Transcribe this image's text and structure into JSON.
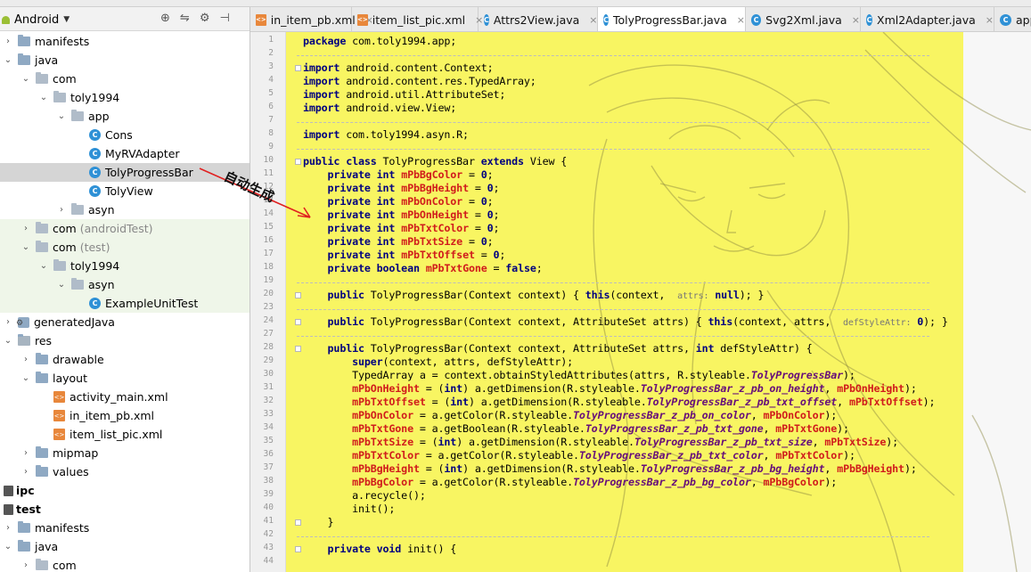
{
  "editor_tabs": [
    {
      "label": "in_item_pb.xml",
      "icon": "xml-file-icon",
      "active": false
    },
    {
      "label": "item_list_pic.xml",
      "icon": "xml-file-icon",
      "active": false
    },
    {
      "label": "Attrs2View.java",
      "icon": "class-icon",
      "active": false
    },
    {
      "label": "TolyProgressBar.java",
      "icon": "class-icon",
      "active": true
    },
    {
      "label": "Svg2Xml.java",
      "icon": "class-icon",
      "active": false
    },
    {
      "label": "Xml2Adapter.java",
      "icon": "class-icon",
      "active": false
    },
    {
      "label": "app",
      "icon": "module-icon",
      "active": false
    }
  ],
  "project_panel": {
    "view_mode": "Android",
    "tree": [
      {
        "label": "manifests",
        "indent": 0,
        "arrow": "›",
        "icon": "folder"
      },
      {
        "label": "java",
        "indent": 0,
        "arrow": "⌄",
        "icon": "folder"
      },
      {
        "label": "com",
        "indent": 1,
        "arrow": "⌄",
        "icon": "package"
      },
      {
        "label": "toly1994",
        "indent": 2,
        "arrow": "⌄",
        "icon": "package"
      },
      {
        "label": "app",
        "indent": 3,
        "arrow": "⌄",
        "icon": "package"
      },
      {
        "label": "Cons",
        "indent": 4,
        "arrow": "",
        "icon": "class"
      },
      {
        "label": "MyRVAdapter",
        "indent": 4,
        "arrow": "",
        "icon": "class"
      },
      {
        "label": "TolyProgressBar",
        "indent": 4,
        "arrow": "",
        "icon": "class",
        "selected": true
      },
      {
        "label": "TolyView",
        "indent": 4,
        "arrow": "",
        "icon": "class"
      },
      {
        "label": "asyn",
        "indent": 3,
        "arrow": "›",
        "icon": "package"
      },
      {
        "label": "com",
        "suffix": "(androidTest)",
        "indent": 1,
        "arrow": "›",
        "icon": "package",
        "test": true
      },
      {
        "label": "com",
        "suffix": "(test)",
        "indent": 1,
        "arrow": "⌄",
        "icon": "package",
        "test": true
      },
      {
        "label": "toly1994",
        "indent": 2,
        "arrow": "⌄",
        "icon": "package",
        "test": true
      },
      {
        "label": "asyn",
        "indent": 3,
        "arrow": "⌄",
        "icon": "package",
        "test": true
      },
      {
        "label": "ExampleUnitTest",
        "indent": 4,
        "arrow": "",
        "icon": "class",
        "test": true
      },
      {
        "label": "generatedJava",
        "indent": 0,
        "arrow": "›",
        "icon": "gear-folder"
      },
      {
        "label": "res",
        "indent": 0,
        "arrow": "⌄",
        "icon": "res"
      },
      {
        "label": "drawable",
        "indent": 1,
        "arrow": "›",
        "icon": "folder"
      },
      {
        "label": "layout",
        "indent": 1,
        "arrow": "⌄",
        "icon": "folder"
      },
      {
        "label": "activity_main.xml",
        "indent": 2,
        "arrow": "",
        "icon": "xml"
      },
      {
        "label": "in_item_pb.xml",
        "indent": 2,
        "arrow": "",
        "icon": "xml"
      },
      {
        "label": "item_list_pic.xml",
        "indent": 2,
        "arrow": "",
        "icon": "xml"
      },
      {
        "label": "mipmap",
        "indent": 1,
        "arrow": "›",
        "icon": "folder"
      },
      {
        "label": "values",
        "indent": 1,
        "arrow": "›",
        "icon": "folder"
      },
      {
        "label": "ipc",
        "indent": -1,
        "arrow": "",
        "icon": "module",
        "bold": true
      },
      {
        "label": "test",
        "indent": -1,
        "arrow": "",
        "icon": "module",
        "bold": true
      },
      {
        "label": "manifests",
        "indent": 0,
        "arrow": "›",
        "icon": "folder"
      },
      {
        "label": "java",
        "indent": 0,
        "arrow": "⌄",
        "icon": "folder"
      },
      {
        "label": "com",
        "indent": 1,
        "arrow": "›",
        "icon": "package"
      }
    ]
  },
  "annotation": {
    "text": "自动生成"
  },
  "code_lines": [
    {
      "n": "1",
      "html": "<span class='kw'>package</span> com.toly1994.app;"
    },
    {
      "n": "2",
      "html": ""
    },
    {
      "n": "3",
      "html": "<span class='kw'>import</span> android.content.Context;"
    },
    {
      "n": "4",
      "html": "<span class='kw'>import</span> android.content.res.TypedArray;"
    },
    {
      "n": "5",
      "html": "<span class='kw'>import</span> android.util.AttributeSet;"
    },
    {
      "n": "6",
      "html": "<span class='kw'>import</span> android.view.View;"
    },
    {
      "n": "7",
      "html": ""
    },
    {
      "n": "8",
      "html": "<span class='kw'>import</span> com.toly1994.asyn.R;"
    },
    {
      "n": "9",
      "html": ""
    },
    {
      "n": "10",
      "html": "<span class='kw'>public class</span> TolyProgressBar <span class='kw'>extends</span> View {"
    },
    {
      "n": "11",
      "html": "    <span class='kw'>private int</span> <span class='fld'>mPbBgColor</span> = <span class='kw'>0</span>;"
    },
    {
      "n": "12",
      "html": "    <span class='kw'>private int</span> <span class='fld'>mPbBgHeight</span> = <span class='kw'>0</span>;"
    },
    {
      "n": "13",
      "html": "    <span class='kw'>private int</span> <span class='fld'>mPbOnColor</span> = <span class='kw'>0</span>;"
    },
    {
      "n": "14",
      "html": "    <span class='kw'>private int</span> <span class='fld'>mPbOnHeight</span> = <span class='kw'>0</span>;"
    },
    {
      "n": "15",
      "html": "    <span class='kw'>private int</span> <span class='fld'>mPbTxtColor</span> = <span class='kw'>0</span>;"
    },
    {
      "n": "16",
      "html": "    <span class='kw'>private int</span> <span class='fld'>mPbTxtSize</span> = <span class='kw'>0</span>;"
    },
    {
      "n": "17",
      "html": "    <span class='kw'>private int</span> <span class='fld'>mPbTxtOffset</span> = <span class='kw'>0</span>;"
    },
    {
      "n": "18",
      "html": "    <span class='kw'>private boolean</span> <span class='fld'>mPbTxtGone</span> = <span class='kw'>false</span>;"
    },
    {
      "n": "19",
      "html": ""
    },
    {
      "n": "20",
      "html": "    <span class='kw'>public</span> TolyProgressBar(Context context) { <span class='kw'>this</span>(context,  <span class='hint'>attrs:</span> <span class='kw'>null</span>); }"
    },
    {
      "n": "23",
      "html": ""
    },
    {
      "n": "24",
      "html": "    <span class='kw'>public</span> TolyProgressBar(Context context, AttributeSet attrs) { <span class='kw'>this</span>(context, attrs,  <span class='hint'>defStyleAttr:</span> <span class='kw'>0</span>); }"
    },
    {
      "n": "27",
      "html": ""
    },
    {
      "n": "28",
      "html": "    <span class='kw'>public</span> TolyProgressBar(Context context, AttributeSet attrs, <span class='kw'>int</span> defStyleAttr) {"
    },
    {
      "n": "29",
      "html": "        <span class='kw'>super</span>(context, attrs, defStyleAttr);"
    },
    {
      "n": "30",
      "html": "        TypedArray a = context.obtainStyledAttributes(attrs, R.styleable.<span class='ital'>TolyProgressBar</span>);"
    },
    {
      "n": "31",
      "html": "        <span class='fld'>mPbOnHeight</span> = (<span class='kw'>int</span>) a.getDimension(R.styleable.<span class='ital'>TolyProgressBar_z_pb_on_height</span>, <span class='fld'>mPbOnHeight</span>);"
    },
    {
      "n": "32",
      "html": "        <span class='fld'>mPbTxtOffset</span> = (<span class='kw'>int</span>) a.getDimension(R.styleable.<span class='ital'>TolyProgressBar_z_pb_txt_offset</span>, <span class='fld'>mPbTxtOffset</span>);"
    },
    {
      "n": "33",
      "html": "        <span class='fld'>mPbOnColor</span> = a.getColor(R.styleable.<span class='ital'>TolyProgressBar_z_pb_on_color</span>, <span class='fld'>mPbOnColor</span>);"
    },
    {
      "n": "34",
      "html": "        <span class='fld'>mPbTxtGone</span> = a.getBoolean(R.styleable.<span class='ital'>TolyProgressBar_z_pb_txt_gone</span>, <span class='fld'>mPbTxtGone</span>);"
    },
    {
      "n": "35",
      "html": "        <span class='fld'>mPbTxtSize</span> = (<span class='kw'>int</span>) a.getDimension(R.styleable.<span class='ital'>TolyProgressBar_z_pb_txt_size</span>, <span class='fld'>mPbTxtSize</span>);"
    },
    {
      "n": "36",
      "html": "        <span class='fld'>mPbTxtColor</span> = a.getColor(R.styleable.<span class='ital'>TolyProgressBar_z_pb_txt_color</span>, <span class='fld'>mPbTxtColor</span>);"
    },
    {
      "n": "37",
      "html": "        <span class='fld'>mPbBgHeight</span> = (<span class='kw'>int</span>) a.getDimension(R.styleable.<span class='ital'>TolyProgressBar_z_pb_bg_height</span>, <span class='fld'>mPbBgHeight</span>);"
    },
    {
      "n": "38",
      "html": "        <span class='fld'>mPbBgColor</span> = a.getColor(R.styleable.<span class='ital'>TolyProgressBar_z_pb_bg_color</span>, <span class='fld'>mPbBgColor</span>);"
    },
    {
      "n": "39",
      "html": "        a.recycle();"
    },
    {
      "n": "40",
      "html": "        init();"
    },
    {
      "n": "41",
      "html": "    }"
    },
    {
      "n": "42",
      "html": ""
    },
    {
      "n": "43",
      "html": "    <span class='kw'>private void</span> init() {"
    },
    {
      "n": "44",
      "html": ""
    }
  ],
  "colors": {
    "highlight": "#f8f562",
    "keyword": "#000080",
    "field": "#d01c1c",
    "styleable": "#660e7a",
    "selection": "#d5d5d5",
    "test_bg": "#eff6e9"
  }
}
